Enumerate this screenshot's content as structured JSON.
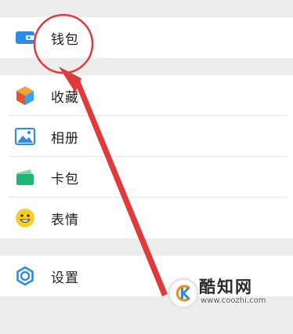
{
  "groups": [
    {
      "items": [
        {
          "label": "钱包",
          "icon": "wallet-icon"
        }
      ]
    },
    {
      "items": [
        {
          "label": "收藏",
          "icon": "favorites-cube-icon"
        },
        {
          "label": "相册",
          "icon": "album-picture-icon"
        },
        {
          "label": "卡包",
          "icon": "card-pack-icon"
        },
        {
          "label": "表情",
          "icon": "smiley-icon"
        }
      ]
    },
    {
      "items": [
        {
          "label": "设置",
          "icon": "settings-gear-icon"
        }
      ]
    }
  ],
  "watermark": {
    "title": "酷知网",
    "url": "www.coozhi.com"
  },
  "colors": {
    "background": "#ededed",
    "annotation_red": "#e03a3a",
    "wallet_blue": "#2b8be6",
    "favorites_orange": "#f2a33a",
    "album_blue": "#2b8be6",
    "card_green": "#21b574",
    "smiley_yellow": "#f6cf2c",
    "settings_blue": "#2b8be6"
  }
}
